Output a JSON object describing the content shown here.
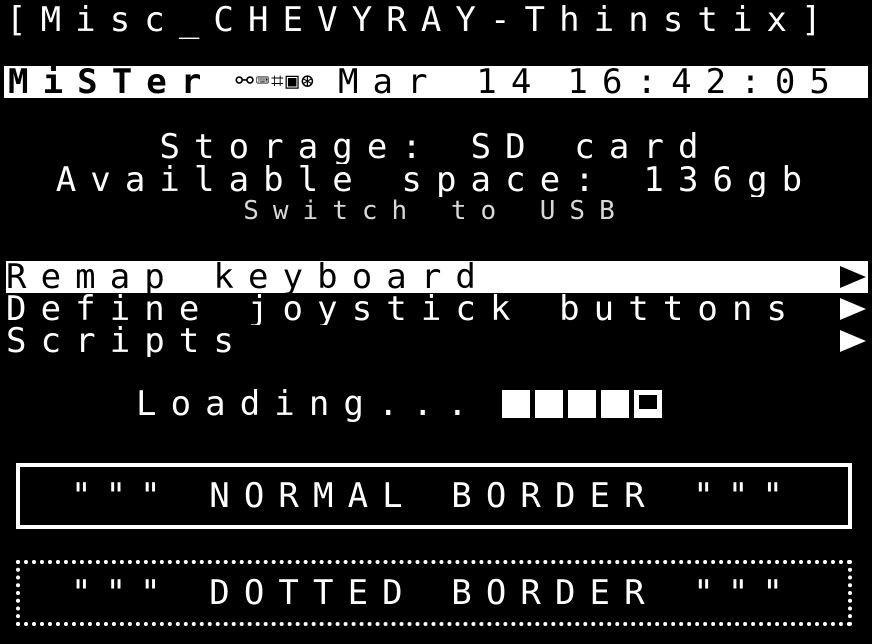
{
  "window": {
    "title": "[Misc_CHEVYRAY-Thinstix]"
  },
  "statusbar": {
    "core": "MiSTer",
    "devices": "⚯⌨⌗▣⊛",
    "date": "Mar 14",
    "time": "16:42:05"
  },
  "info": {
    "storage": "Storage: SD card",
    "space": "Available space: 136gb",
    "hint": "Switch to USB"
  },
  "menu": {
    "items": [
      {
        "label": "Remap keyboard"
      },
      {
        "label": "Define joystick buttons"
      },
      {
        "label": "Scripts"
      }
    ]
  },
  "loading": {
    "label": "Loading...",
    "progress": 0.9
  },
  "boxes": {
    "normal": "\"\"\" NORMAL BORDER \"\"\"",
    "dotted": "\"\"\" DOTTED BORDER \"\"\""
  }
}
